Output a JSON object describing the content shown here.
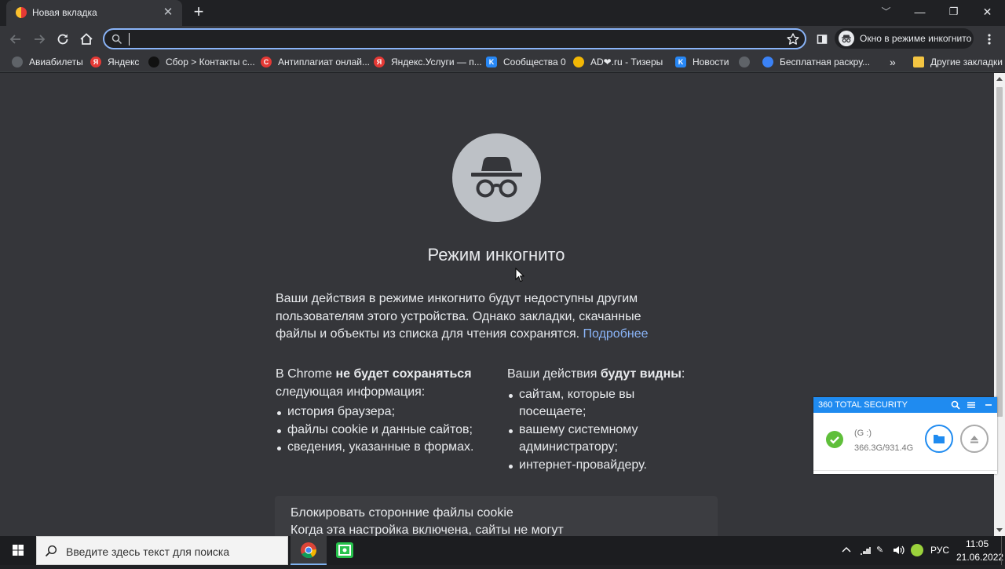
{
  "tab": {
    "title": "Новая вкладка",
    "close": "✕",
    "new_tab": "+"
  },
  "window_controls": {
    "minimize": "—",
    "maximize": "❐",
    "close": "✕",
    "menu": "﹀"
  },
  "toolbar": {
    "omnibox_value": "",
    "incognito_label": "Окно в режиме инкогнито"
  },
  "bookmarks": {
    "items": [
      {
        "label": "Авиабилеты",
        "icon": "globe-icon",
        "color": "#5f6368"
      },
      {
        "label": "Яндекс",
        "icon": "yandex-icon",
        "color": "#e53935"
      },
      {
        "label": "Сбор > Контакты с...",
        "icon": "dark-circle-icon",
        "color": "#111111"
      },
      {
        "label": "Антиплагиат онлай...",
        "icon": "antiplagiat-icon",
        "color": "#e53935"
      },
      {
        "label": "Яндекс.Услуги — п...",
        "icon": "yandex-icon",
        "color": "#e53935"
      },
      {
        "label": "Сообщества 0",
        "icon": "vk-icon",
        "color": "#2787f5"
      },
      {
        "label": "AD❤.ru - Тизеры",
        "icon": "ad-icon",
        "color": "#f2b705"
      },
      {
        "label": "Новости",
        "icon": "vk-icon",
        "color": "#2787f5"
      },
      {
        "label": "",
        "icon": "globe-icon",
        "color": "#5f6368"
      },
      {
        "label": "Бесплатная раскру...",
        "icon": "thumb-icon",
        "color": "#3b82f6"
      }
    ],
    "overflow": "»",
    "other": "Другие закладки"
  },
  "page": {
    "heading": "Режим инкогнито",
    "intro": "Ваши действия в режиме инкогнито будут недоступны другим пользователям этого устройства. Однако закладки, скачанные файлы и объекты из списка для чтения сохранятся.",
    "learn_more": "Подробнее",
    "left_col": {
      "pre": "В Chrome ",
      "bold": "не будет сохраняться",
      "post": " следующая информация:",
      "items": [
        "история браузера;",
        "файлы cookie и данные сайтов;",
        "сведения, указанные в формах."
      ]
    },
    "right_col": {
      "pre": "Ваши действия ",
      "bold": "будут видны",
      "post": ":",
      "items": [
        "сайтам, которые вы посещаете;",
        "вашему системному администратору;",
        "интернет-провайдеру."
      ]
    },
    "cookie_title": "Блокировать сторонние файлы cookie",
    "cookie_desc": "Когда эта настройка включена, сайты не могут"
  },
  "security_popup": {
    "title": "360 TOTAL SECURITY",
    "drive": "(G :)",
    "size": "366.3G/931.4G"
  },
  "taskbar": {
    "search_placeholder": "Введите здесь текст для поиска",
    "lang": "РУС",
    "time": "11:05",
    "date": "21.06.2022"
  }
}
